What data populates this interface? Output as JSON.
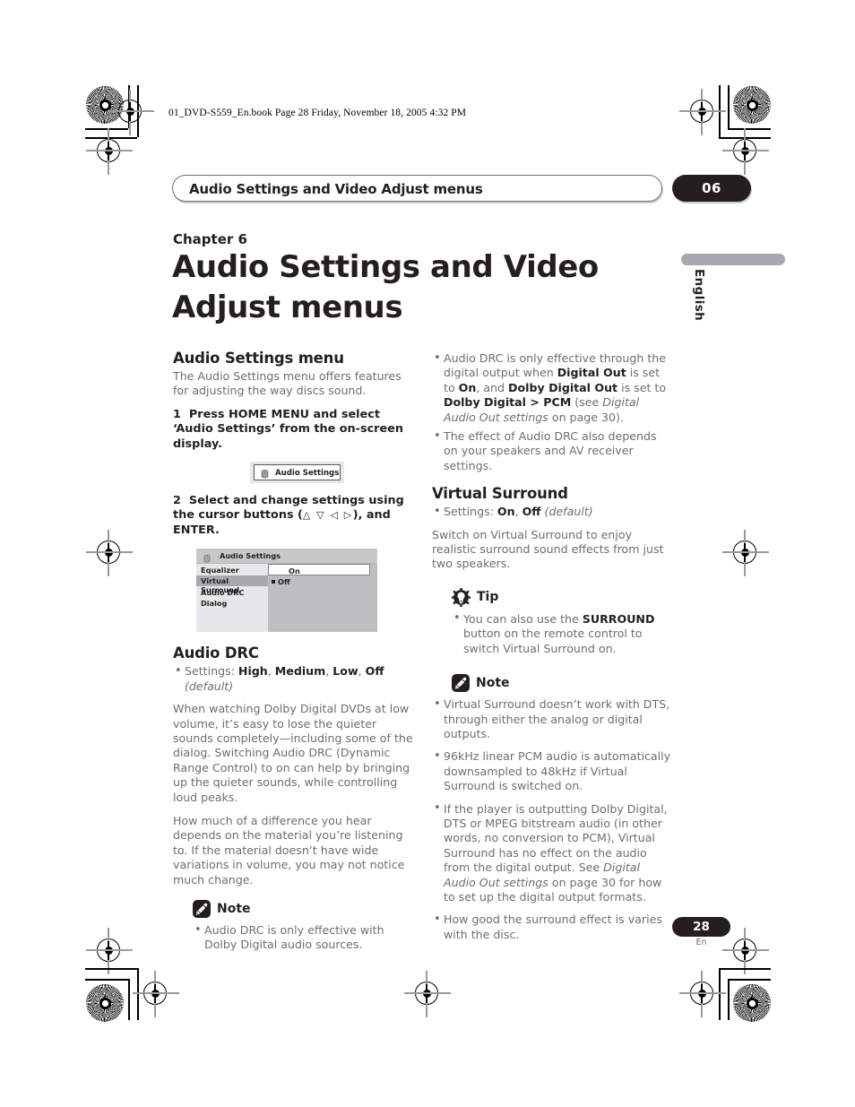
{
  "print_marks": {
    "book_line": "01_DVD-S559_En.book  Page 28  Friday, November 18, 2005  4:32 PM"
  },
  "running_head": {
    "title": "Audio Settings and Video Adjust menus",
    "chapter_badge": "06"
  },
  "side_tab": {
    "language": "English"
  },
  "chapter": {
    "label": "Chapter 6",
    "title": "Audio Settings and Video Adjust menus"
  },
  "left_column": {
    "section_title": "Audio Settings menu",
    "intro": "The Audio Settings menu offers features for adjusting the way discs sound.",
    "step1_num": "1",
    "step1_text": "Press HOME MENU and select ‘Audio Settings’ from the on-screen display.",
    "osd_button_label": "Audio Settings",
    "step2_num": "2",
    "step2_text_a": "Select and change settings using the cursor buttons (",
    "step2_arrows": "△ ▽ ◁ ▷",
    "step2_text_b": "), and ENTER.",
    "osd": {
      "title": "Audio Settings",
      "menu_items": [
        "Equalizer",
        "Virtual Surround",
        "Audio DRC",
        "Dialog"
      ],
      "selected_item": "Virtual Surround",
      "value_field": "On",
      "option": "Off"
    },
    "drc_title": "Audio DRC",
    "drc_settings_prefix": "Settings: ",
    "drc_settings_values": [
      "High",
      "Medium",
      "Low",
      "Off"
    ],
    "drc_settings_default": "(default)",
    "drc_para_1": "When watching Dolby Digital DVDs at low volume, it’s easy to lose the quieter sounds completely—including some of the dialog. Switching Audio DRC (Dynamic Range Control) to on can help by bringing up the quieter sounds, while controlling loud peaks.",
    "drc_para_2": "How much of a difference you hear depends on the material you’re listening to. If the material doesn’t have wide variations in volume, you may not notice much change.",
    "note_label": "Note",
    "note_icon": "note-pencil-icon",
    "note_bullets": [
      "Audio DRC is only effective with Dolby Digital audio sources."
    ]
  },
  "right_column": {
    "top_bullet_1": {
      "t1": "Audio DRC is only effective through the digital output when ",
      "b1": "Digital Out",
      "t2": " is set to ",
      "b2": "On",
      "t3": ", and ",
      "b3": "Dolby Digital Out",
      "t4": " is set to ",
      "b4": "Dolby Digital > PCM",
      "t5": " (see ",
      "i1": "Digital Audio Out settings",
      "t6": " on page 30)."
    },
    "top_bullet_2": "The effect of Audio DRC also depends on your speakers and AV receiver settings.",
    "vs_title": "Virtual Surround",
    "vs_settings_prefix": "Settings: ",
    "vs_settings_values": [
      "On",
      "Off"
    ],
    "vs_settings_default": "(default)",
    "vs_para": "Switch on Virtual Surround to enjoy realistic surround sound effects from just two speakers.",
    "tip_label": "Tip",
    "tip_icon": "gear-lightbulb-icon",
    "tip_bullet": {
      "t1": "You can also use the ",
      "b1": "SURROUND",
      "t2": " button on the remote control to switch Virtual Surround on."
    },
    "note_label": "Note",
    "note_icon": "note-pencil-icon",
    "note_bullet_1": "Virtual Surround doesn’t work with DTS, through either the analog or digital outputs.",
    "note_bullet_2": "96kHz linear PCM audio is automatically downsampled to 48kHz if Virtual Surround is switched on.",
    "note_bullet_3": {
      "t1": "If the player is outputting Dolby Digital, DTS or MPEG bitstream audio (in other words, no conversion to PCM), Virtual Surround has no effect on the audio from the digital output. See ",
      "i1": "Digital Audio Out settings",
      "t2": " on page 30 for how to set up the digital output formats."
    },
    "note_bullet_4": "How good the surround effect is varies with the disc."
  },
  "footer": {
    "page_number": "28",
    "language_code": "En"
  },
  "colors": {
    "ink_black": "#231f20",
    "body_gray": "#6d6e71",
    "rule_gray": "#a7a9ac"
  }
}
